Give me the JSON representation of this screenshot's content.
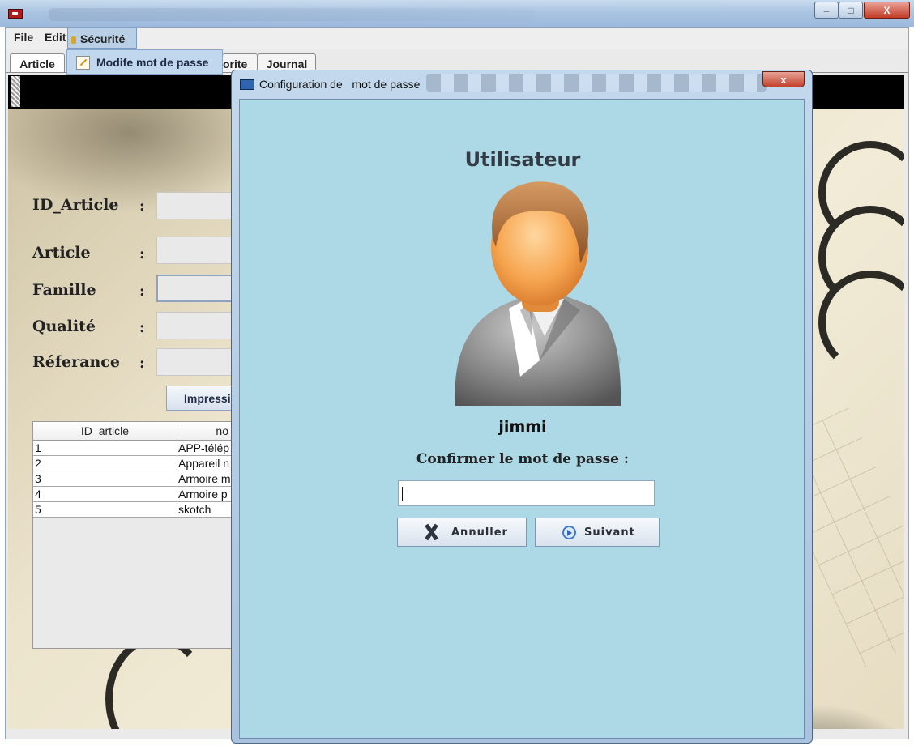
{
  "window": {
    "title_controls": {
      "minimize": "–",
      "maximize": "□",
      "close": "X"
    }
  },
  "menubar": {
    "file": "File",
    "edit": "Edit",
    "securite": "Sécurité"
  },
  "tabs": {
    "article": "Article",
    "hidden_partial": "orite",
    "journal": "Journal"
  },
  "dropdown": {
    "item": "Modife mot de passe"
  },
  "form": {
    "labels": {
      "id_article": "ID_Article",
      "article": "Article",
      "famille": "Famille",
      "qualite": "Qualité",
      "referance": "Réferance"
    },
    "colon": ":",
    "print_button": "Impressi"
  },
  "table": {
    "headers": [
      "ID_article",
      "no"
    ],
    "rows": [
      [
        "1",
        "APP-télép"
      ],
      [
        "2",
        "Appareil n"
      ],
      [
        "3",
        "Armoire m"
      ],
      [
        "4",
        "Armoire p"
      ],
      [
        "5",
        "skotch"
      ]
    ]
  },
  "dialog": {
    "title": "Configuration de   mot de passe",
    "close": "x",
    "heading": "Utilisateur",
    "username": "jimmi",
    "prompt": "Confirmer le mot de passe :",
    "password_value": "",
    "cancel_label": "Annuller",
    "next_label": "Suivant"
  },
  "colors": {
    "dialog_background": "#add8e6",
    "menu_highlight": "#b8cfe5",
    "close_button": "#c3412c"
  },
  "icons": [
    "app-icon",
    "lock-icon",
    "pencil-icon",
    "avatar-icon",
    "cancel-x-icon",
    "next-arrow-icon",
    "dialog-app-icon"
  ]
}
